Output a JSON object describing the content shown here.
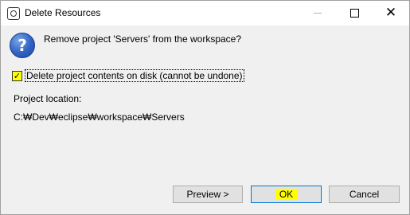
{
  "window": {
    "title": "Delete Resources",
    "icon": "eclipse-icon"
  },
  "titlebar_buttons": {
    "minimize": "minimize-icon",
    "maximize": "maximize-icon",
    "close": "close-icon",
    "close_glyph": "✕"
  },
  "dialog": {
    "icon": "question-icon",
    "icon_glyph": "?",
    "message": "Remove project 'Servers' from the workspace?",
    "delete_contents": {
      "checked": true,
      "check_glyph": "✓",
      "label": "Delete project contents on disk (cannot be undone)"
    },
    "location_label": "Project location:",
    "location_value": "C:₩Dev₩eclipse₩workspace₩Servers"
  },
  "buttons": {
    "preview": "Preview >",
    "ok": "OK",
    "cancel": "Cancel"
  },
  "colors": {
    "highlight": "#ffff00",
    "default_button_border": "#0078d7",
    "dialog_background": "#f0f0f0"
  }
}
